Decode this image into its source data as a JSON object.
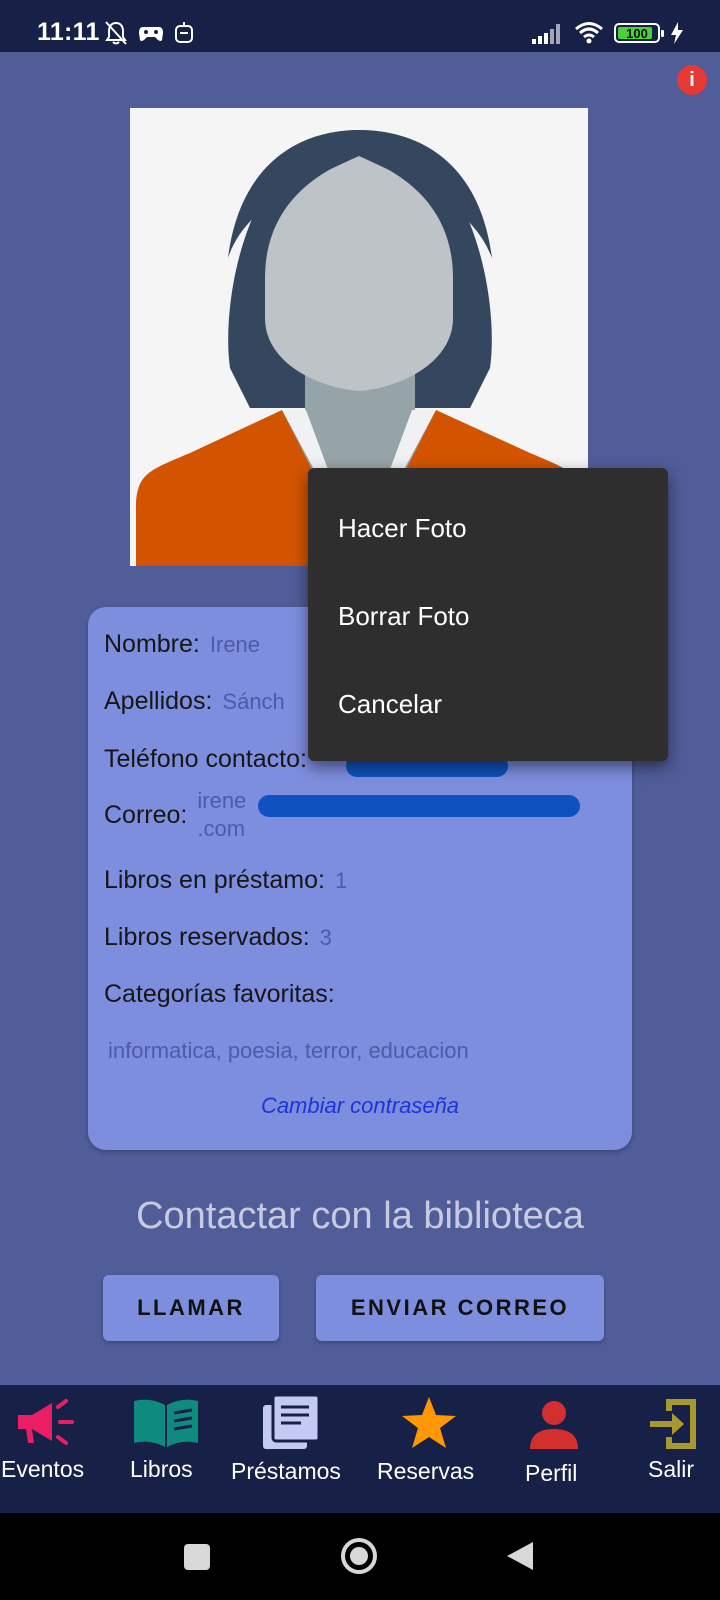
{
  "status_bar": {
    "time": "11:11",
    "battery": "100"
  },
  "profile": {
    "fields": [
      {
        "label": "Nombre:",
        "value": "Irene"
      },
      {
        "label": "Apellidos:",
        "value": "Sánch"
      },
      {
        "label": "Teléfono contacto:",
        "value": ""
      },
      {
        "label": "Correo:",
        "value_line1": "irene",
        "value_line2": ".com"
      },
      {
        "label": "Libros en préstamo:",
        "value": "1"
      },
      {
        "label": "Libros reservados:",
        "value": "3"
      },
      {
        "label": "Categorías favoritas:",
        "value": "informatica, poesia, terror, educacion"
      }
    ],
    "change_password": "Cambiar contraseña"
  },
  "contact": {
    "title": "Contactar con la biblioteca",
    "call_button": "LLAMAR",
    "email_button": "ENVIAR CORREO"
  },
  "popup_menu": {
    "items": [
      "Hacer Foto",
      "Borrar Foto",
      "Cancelar"
    ]
  },
  "bottom_nav": {
    "items": [
      {
        "label": "Eventos",
        "icon": "megaphone-icon",
        "color": "#e91e63"
      },
      {
        "label": "Libros",
        "icon": "open-book-icon",
        "color": "#0f8a7e"
      },
      {
        "label": "Préstamos",
        "icon": "documents-icon",
        "color": "#c5caf5"
      },
      {
        "label": "Reservas",
        "icon": "star-icon",
        "color": "#ff9800"
      },
      {
        "label": "Perfil",
        "icon": "person-icon",
        "color": "#d32f2f"
      },
      {
        "label": "Salir",
        "icon": "exit-icon",
        "color": "#a8992f"
      }
    ]
  },
  "colors": {
    "background": "#515d99",
    "card": "#7e8edf",
    "nav_bar": "#172148",
    "link": "#1d35d8",
    "popup": "#2e2e2e"
  }
}
